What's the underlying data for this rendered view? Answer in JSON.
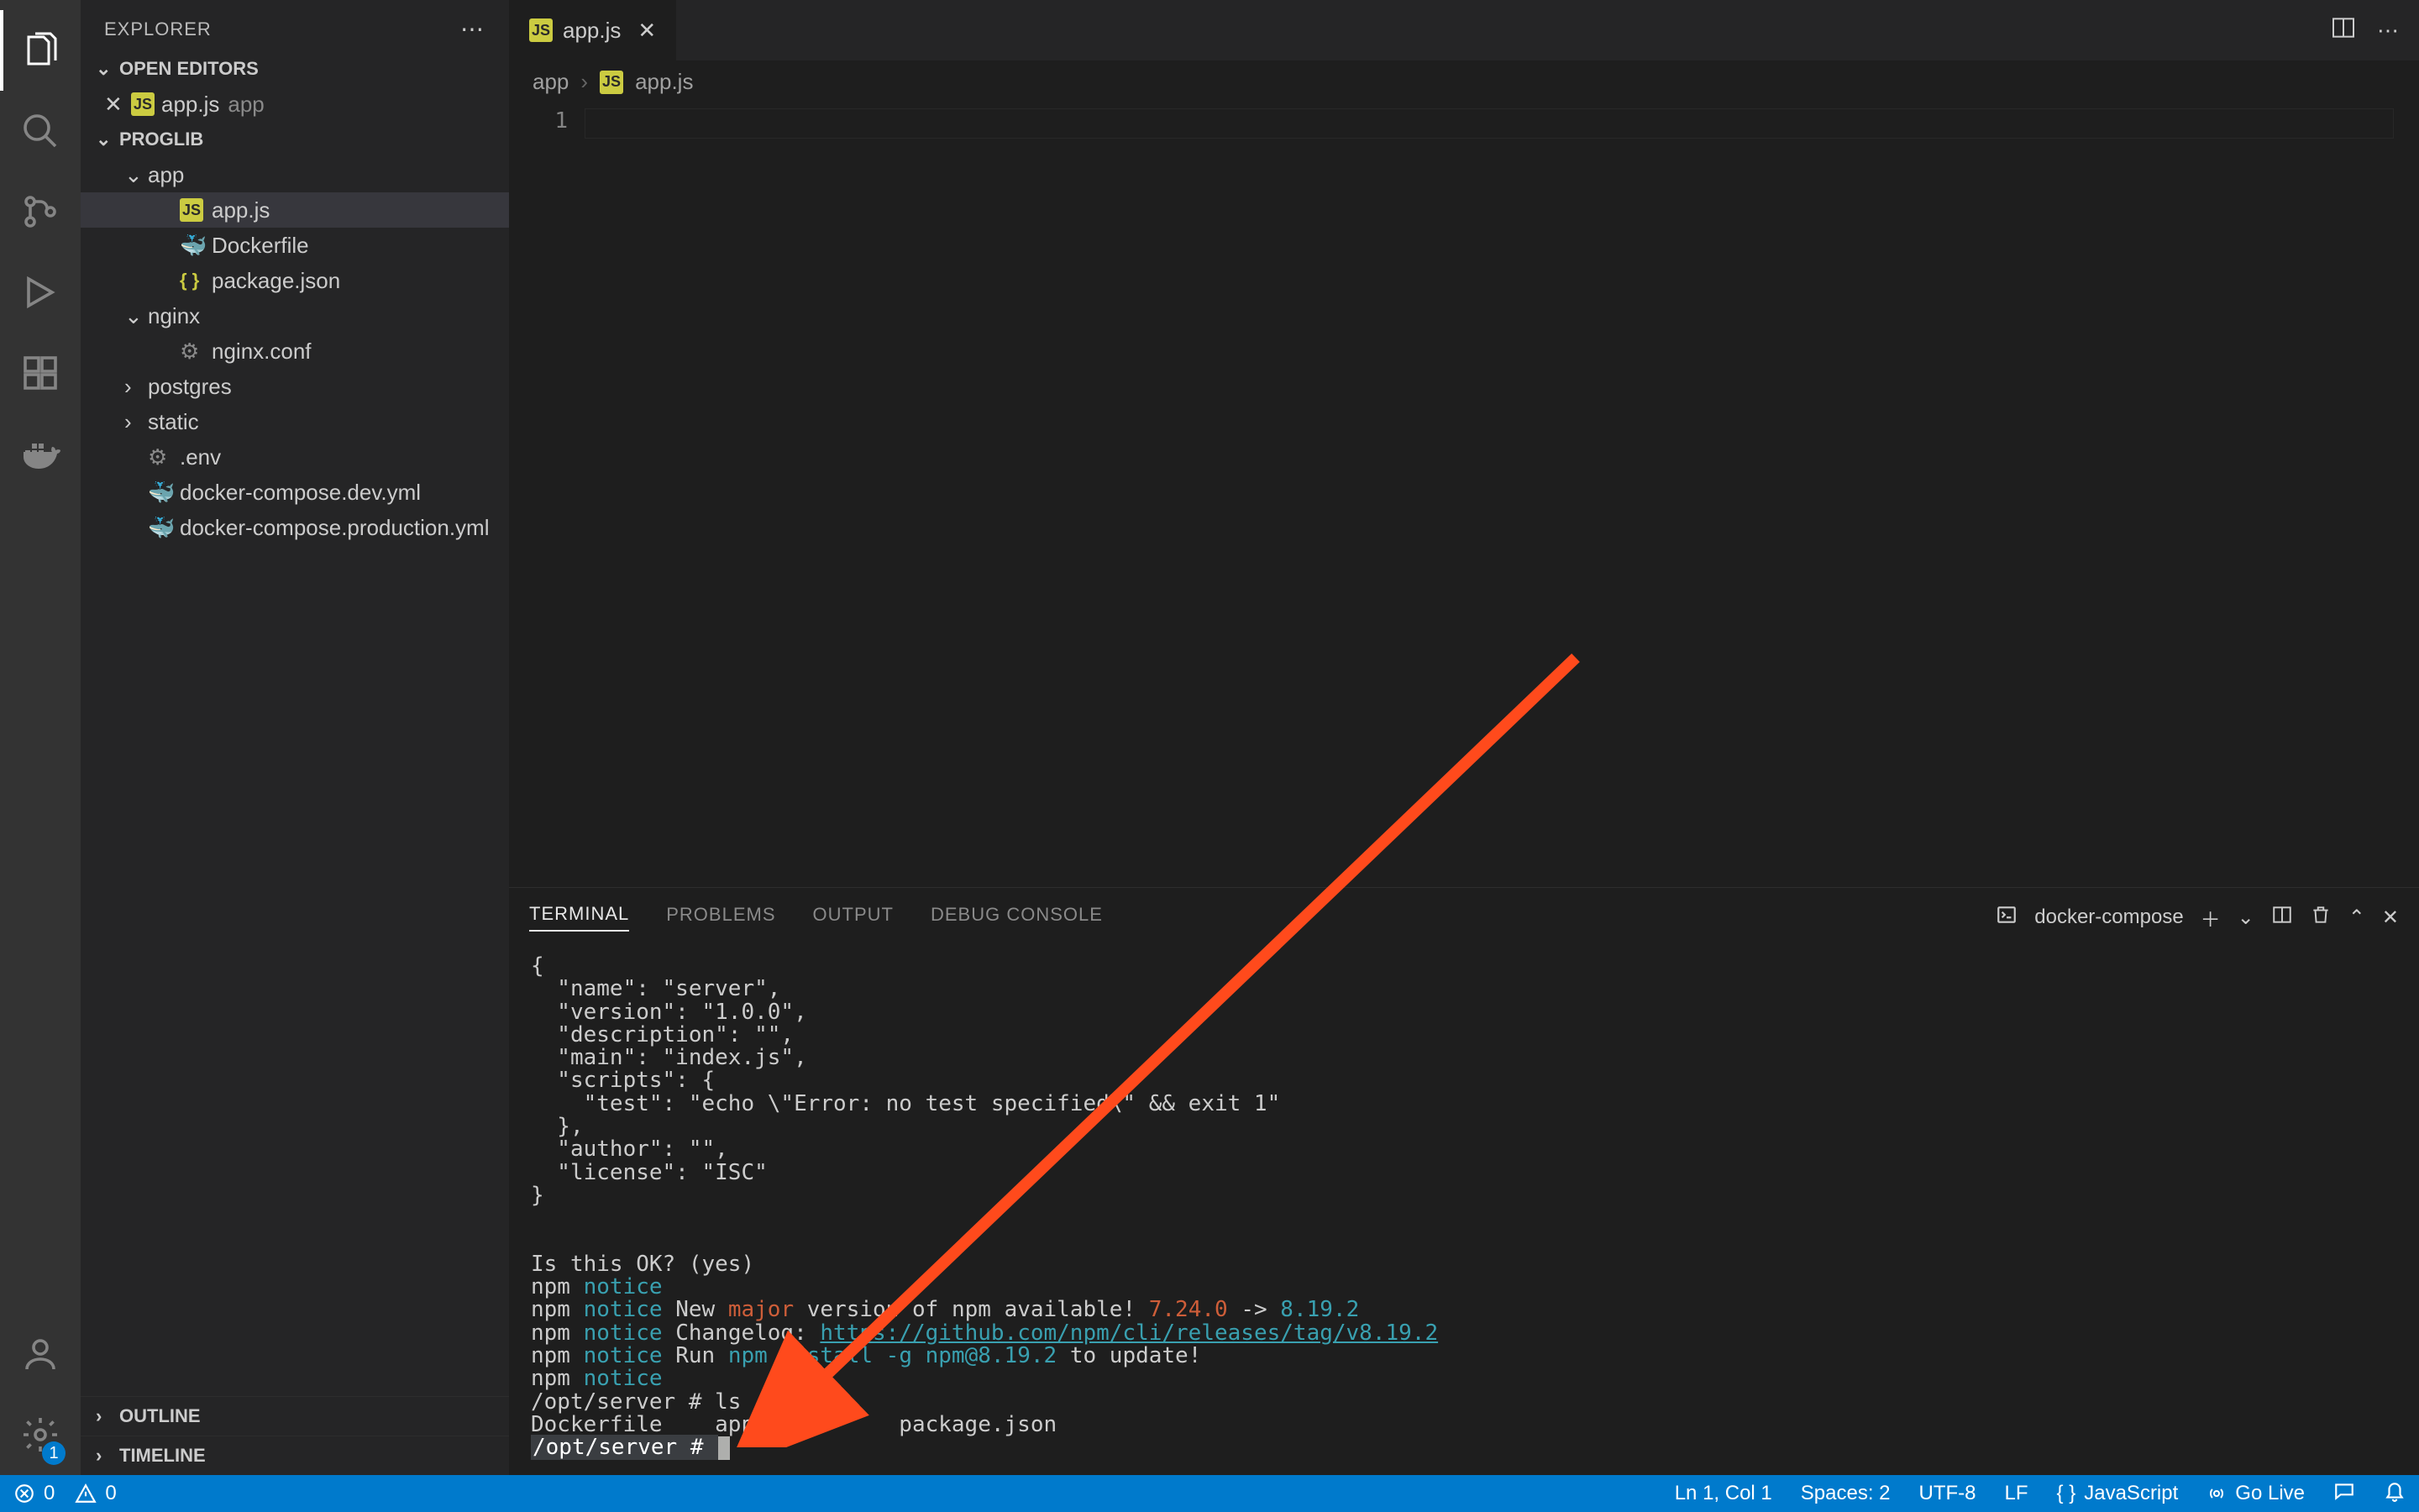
{
  "sidebar": {
    "title": "EXPLORER",
    "openEditors": {
      "label": "OPEN EDITORS",
      "items": [
        {
          "name": "app.js",
          "dir": "app",
          "iconText": "JS"
        }
      ]
    },
    "workspace": {
      "name": "PROGLIB",
      "tree": [
        {
          "type": "folder",
          "name": "app",
          "expanded": true,
          "indent": 1
        },
        {
          "type": "file",
          "name": "app.js",
          "iconText": "JS",
          "indent": 2,
          "selected": true
        },
        {
          "type": "file",
          "name": "Dockerfile",
          "iconClass": "docker-icon",
          "iconGlyph": "🐳",
          "indent": 2
        },
        {
          "type": "file",
          "name": "package.json",
          "iconClass": "json-icon",
          "iconGlyph": "{ }",
          "indent": 2
        },
        {
          "type": "folder",
          "name": "nginx",
          "expanded": true,
          "indent": 1
        },
        {
          "type": "file",
          "name": "nginx.conf",
          "iconClass": "gear-icon",
          "iconGlyph": "⚙",
          "indent": 2
        },
        {
          "type": "folder",
          "name": "postgres",
          "expanded": false,
          "indent": 1
        },
        {
          "type": "folder",
          "name": "static",
          "expanded": false,
          "indent": 1
        },
        {
          "type": "file",
          "name": ".env",
          "iconClass": "gear-icon",
          "iconGlyph": "⚙",
          "indent": 1
        },
        {
          "type": "file",
          "name": "docker-compose.dev.yml",
          "iconClass": "docker-icon",
          "iconGlyph": "🐳",
          "indent": 1
        },
        {
          "type": "file",
          "name": "docker-compose.production.yml",
          "iconClass": "docker-icon",
          "iconGlyph": "🐳",
          "indent": 1
        }
      ]
    },
    "outline": "OUTLINE",
    "timeline": "TIMELINE"
  },
  "tabs": {
    "open": [
      {
        "name": "app.js",
        "iconText": "JS"
      }
    ]
  },
  "breadcrumbs": {
    "seg1": "app",
    "seg2": "app.js",
    "seg2IconText": "JS"
  },
  "editor": {
    "lineNumbers": [
      "1"
    ]
  },
  "panel": {
    "tabs": {
      "terminal": "TERMINAL",
      "problems": "PROBLEMS",
      "output": "OUTPUT",
      "debug": "DEBUG CONSOLE"
    },
    "taskName": "docker-compose"
  },
  "terminal": {
    "packageJson": "{\n  \"name\": \"server\",\n  \"version\": \"1.0.0\",\n  \"description\": \"\",\n  \"main\": \"index.js\",\n  \"scripts\": {\n    \"test\": \"echo \\\"Error: no test specified\\\" && exit 1\"\n  },\n  \"author\": \"\",\n  \"license\": \"ISC\"\n}\n\n",
    "okPrompt": "Is this OK? (yes)",
    "npm": "npm",
    "notice": "notice",
    "major": "major",
    "line1a": " New ",
    "line1b": " version of npm available! ",
    "ver1": "7.24.0",
    "arrow": " -> ",
    "ver2": "8.19.2",
    "line2a": " Changelog: ",
    "link": "https://github.com/npm/cli/releases/tag/v8.19.2",
    "line3a": " Run ",
    "cmd": "npm install -g npm@8.19.2",
    "line3b": " to update!",
    "promptPath": "/opt/server #",
    "lsCmd": " ls",
    "lsOutput": "Dockerfile    app.js        package.json"
  },
  "statusbar": {
    "errors": "0",
    "warnings": "0",
    "lncol": "Ln 1, Col 1",
    "spaces": "Spaces: 2",
    "encoding": "UTF-8",
    "eol": "LF",
    "lang": "JavaScript",
    "golive": "Go Live"
  },
  "settingsBadge": "1"
}
